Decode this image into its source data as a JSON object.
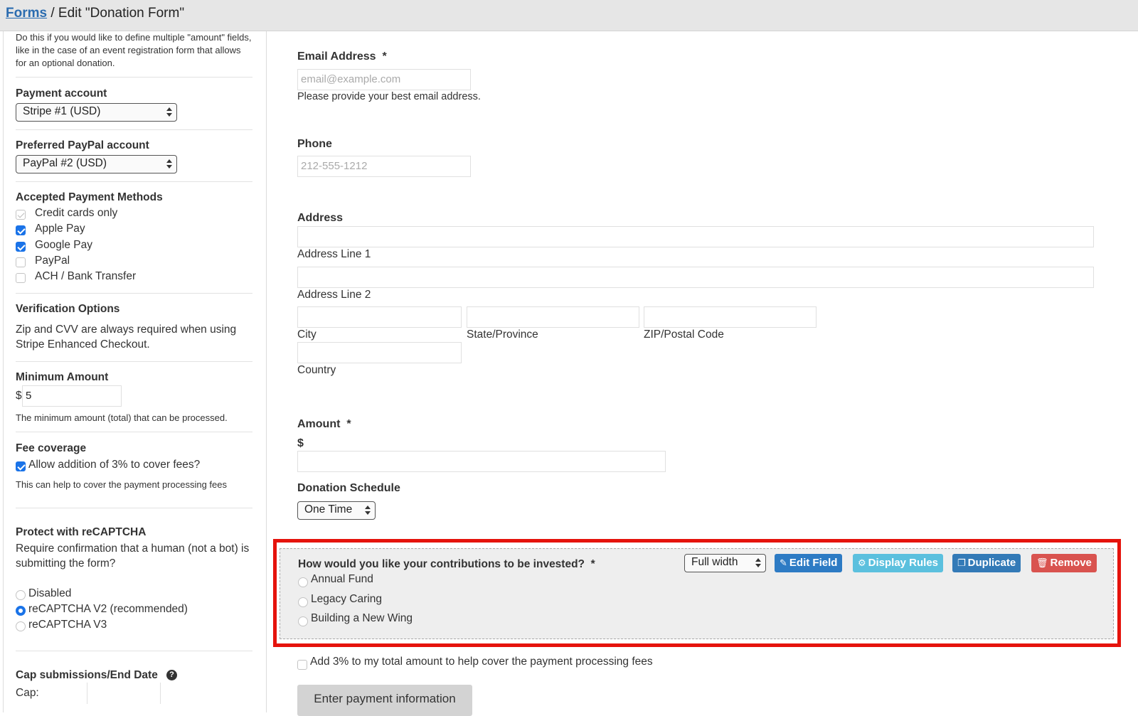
{
  "breadcrumb": {
    "link": "Forms",
    "rest": " / Edit \"Donation Form\""
  },
  "sidebar": {
    "intro_text": "Do this if you would like to define multiple \"amount\" fields, like in the case of an event registration form that allows for an optional donation.",
    "payment_account": {
      "label": "Payment account",
      "value": "Stripe #1 (USD)"
    },
    "paypal_account": {
      "label": "Preferred PayPal account",
      "value": "PayPal #2 (USD)"
    },
    "payment_methods": {
      "label": "Accepted Payment Methods",
      "items": [
        {
          "label": "Credit cards only",
          "checked": true,
          "disabled": true
        },
        {
          "label": "Apple Pay",
          "checked": true
        },
        {
          "label": "Google Pay",
          "checked": true
        },
        {
          "label": "PayPal",
          "checked": false
        },
        {
          "label": "ACH / Bank Transfer",
          "checked": false
        }
      ]
    },
    "verification": {
      "label": "Verification Options",
      "text": "Zip and CVV are always required when using Stripe Enhanced Checkout."
    },
    "minimum_amount": {
      "label": "Minimum Amount",
      "currency": "$",
      "value": "5",
      "help": "The minimum amount (total) that can be processed."
    },
    "fee_coverage": {
      "label": "Fee coverage",
      "checkbox_label": "Allow addition of 3% to cover fees?",
      "help": "This can help to cover the payment processing fees"
    },
    "recaptcha": {
      "label": "Protect with reCAPTCHA",
      "text": "Require confirmation that a human (not a bot) is submitting the form?",
      "options": [
        {
          "label": "Disabled",
          "selected": false
        },
        {
          "label": "reCAPTCHA V2 (recommended)",
          "selected": true
        },
        {
          "label": "reCAPTCHA V3",
          "selected": false
        }
      ]
    },
    "cap": {
      "label": "Cap submissions/End Date",
      "help_icon": "question-circle-icon",
      "cap_label": "Cap:"
    }
  },
  "form": {
    "email": {
      "label": "Email Address",
      "required": "*",
      "placeholder": "email@example.com",
      "help": "Please provide your best email address."
    },
    "phone": {
      "label": "Phone",
      "placeholder": "212-555-1212"
    },
    "address": {
      "label": "Address",
      "line1": "Address Line 1",
      "line2": "Address Line 2",
      "city": "City",
      "state": "State/Province",
      "zip": "ZIP/Postal Code",
      "country": "Country"
    },
    "amount": {
      "label": "Amount",
      "required": "*",
      "currency": "$"
    },
    "schedule": {
      "label": "Donation Schedule",
      "value": "One Time"
    },
    "invest": {
      "question": "How would you like your contributions to be invested?",
      "required": "*",
      "width_select": "Full width",
      "buttons": {
        "edit": "Edit Field",
        "rules": "Display Rules",
        "duplicate": "Duplicate",
        "remove": "Remove"
      },
      "options": [
        "Annual Fund",
        "Legacy Caring",
        "Building a New Wing"
      ]
    },
    "fee_checkbox": "Add 3% to my total amount to help cover the payment processing fees",
    "submit": "Enter payment information"
  },
  "colors": {
    "link": "#2b6cb0",
    "edit": "#2d7bc4",
    "rules": "#5bc0de",
    "duplicate": "#337ab7",
    "remove": "#d9534f",
    "highlight": "#e5130c"
  }
}
